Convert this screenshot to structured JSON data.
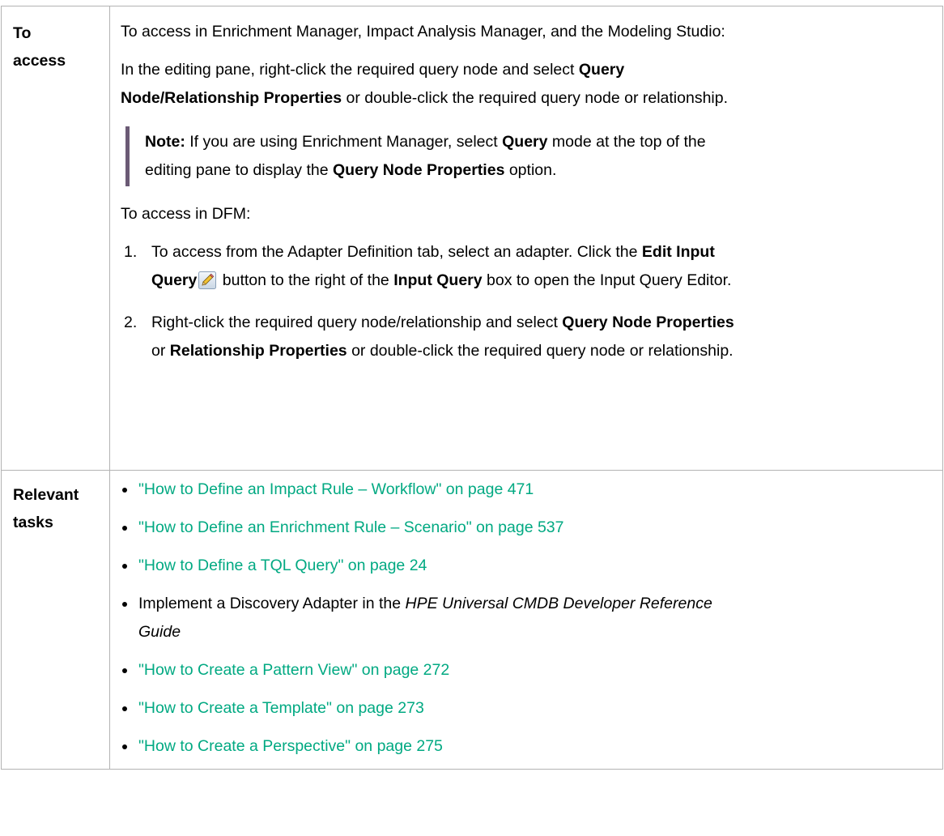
{
  "access": {
    "label_line1": "To",
    "label_line2": "access",
    "intro": "To access in Enrichment Manager, Impact Analysis Manager, and the Modeling Studio:",
    "editing_pre": "In the editing pane, right-click the required query node and select ",
    "editing_bold1": "Query",
    "editing_bold2": "Node/Relationship Properties",
    "editing_post": " or double-click the required query node or relationship.",
    "note": {
      "label": "Note:",
      "t1": " If you are using Enrichment Manager, select ",
      "b1": "Query",
      "t2": " mode at the top of the",
      "t3": "editing pane to display the ",
      "b2": "Query Node Properties",
      "t4": " option."
    },
    "dfm_intro": "To access in DFM:",
    "steps": [
      {
        "num": "1.",
        "t1": "To access from the Adapter Definition tab, select an adapter. Click the ",
        "b1": "Edit Input",
        "b2": "Query",
        "t2": " button to the right of the ",
        "b3": "Input Query",
        "t3": " box to open the Input Query Editor."
      },
      {
        "num": "2.",
        "t1": "Right-click the required query node/relationship and select ",
        "b1": "Query Node Properties",
        "t2": "or ",
        "b2": "Relationship Properties",
        "t3": " or double-click the required query node or relationship."
      }
    ]
  },
  "tasks": {
    "label_line1": "Relevant",
    "label_line2": "tasks",
    "items": [
      {
        "link": "\"How to Define an Impact Rule – Workflow\" on page 471"
      },
      {
        "link": "\"How to Define an Enrichment Rule – Scenario\" on page 537"
      },
      {
        "link": "\"How to Define a TQL Query\" on page 24"
      },
      {
        "pre": "Implement a Discovery Adapter in the ",
        "italic1": "HPE Universal CMDB Developer Reference",
        "italic2": "Guide"
      },
      {
        "link": "\"How to Create a Pattern View\" on page 272"
      },
      {
        "link": "\"How to Create a Template\" on page 273"
      },
      {
        "link": "\"How to Create a Perspective\" on page 275"
      }
    ]
  },
  "colors": {
    "link": "#01a982",
    "note_bar": "#6b5a75",
    "border": "#b3b3b3"
  },
  "icons": {
    "edit_input_query": "pencil-icon"
  }
}
